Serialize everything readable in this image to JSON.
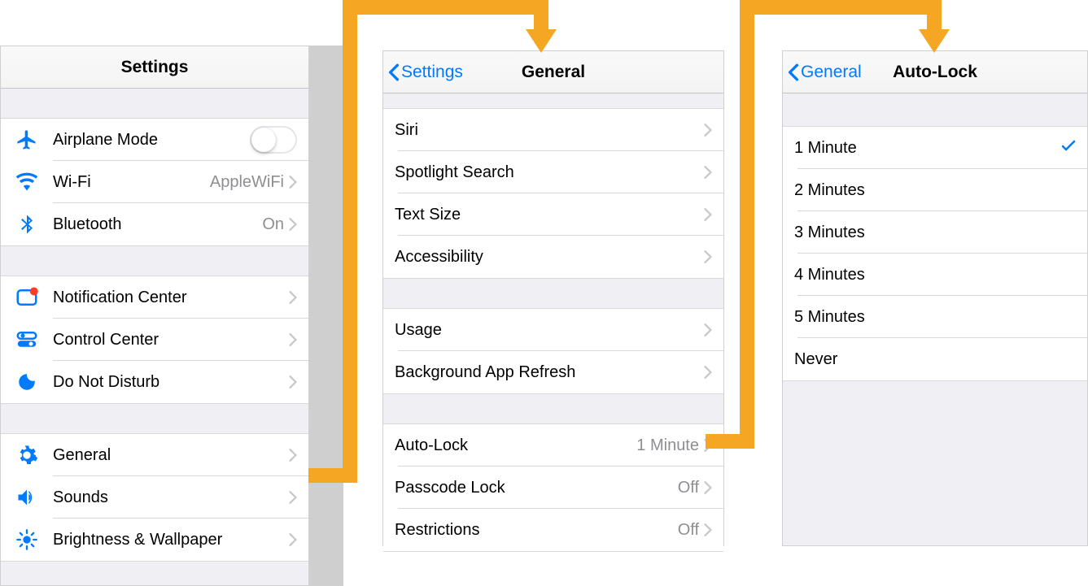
{
  "settings": {
    "title": "Settings",
    "group1": [
      {
        "icon": "airplane",
        "label": "Airplane Mode",
        "control": "toggle"
      },
      {
        "icon": "wifi",
        "label": "Wi-Fi",
        "value": "AppleWiFi",
        "chev": true
      },
      {
        "icon": "bluetooth",
        "label": "Bluetooth",
        "value": "On",
        "chev": true
      }
    ],
    "group2": [
      {
        "icon": "notification",
        "label": "Notification Center",
        "chev": true
      },
      {
        "icon": "control",
        "label": "Control Center",
        "chev": true
      },
      {
        "icon": "dnd",
        "label": "Do Not Disturb",
        "chev": true
      }
    ],
    "group3": [
      {
        "icon": "general",
        "label": "General",
        "chev": true
      },
      {
        "icon": "sounds",
        "label": "Sounds",
        "chev": true
      },
      {
        "icon": "brightness",
        "label": "Brightness & Wallpaper",
        "chev": true
      }
    ]
  },
  "general": {
    "back": "Settings",
    "title": "General",
    "group1": [
      {
        "label": "Siri"
      },
      {
        "label": "Spotlight Search"
      },
      {
        "label": "Text Size"
      },
      {
        "label": "Accessibility"
      }
    ],
    "group2": [
      {
        "label": "Usage"
      },
      {
        "label": "Background App Refresh"
      }
    ],
    "group3": [
      {
        "label": "Auto-Lock",
        "value": "1 Minute"
      },
      {
        "label": "Passcode Lock",
        "value": "Off"
      },
      {
        "label": "Restrictions",
        "value": "Off"
      }
    ]
  },
  "autolock": {
    "back": "General",
    "title": "Auto-Lock",
    "options": [
      {
        "label": "1 Minute",
        "checked": true
      },
      {
        "label": "2 Minutes"
      },
      {
        "label": "3 Minutes"
      },
      {
        "label": "4 Minutes"
      },
      {
        "label": "5 Minutes"
      },
      {
        "label": "Never"
      }
    ]
  }
}
